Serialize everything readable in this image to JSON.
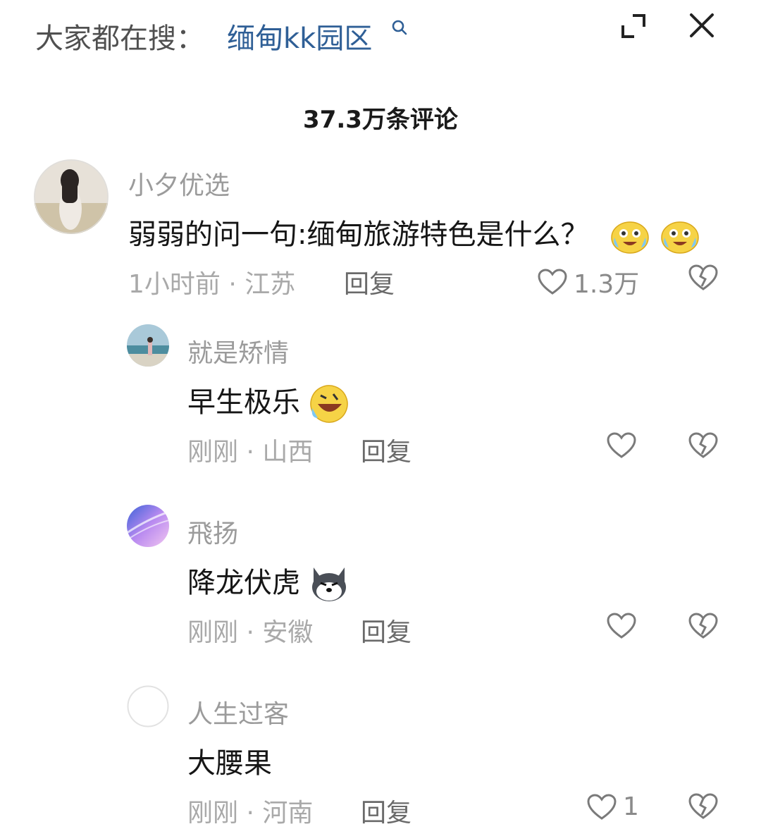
{
  "header": {
    "search_prefix": "大家都在搜：",
    "search_term": "缅甸kk园区",
    "icons": [
      "search-icon",
      "expand-icon",
      "close-icon"
    ]
  },
  "comment_count": "37.3万条评论",
  "comments": [
    {
      "username": "小夕优选",
      "text": "弱弱的问一句:缅甸旅游特色是什么？",
      "emojis": [
        "crying-laughing-emoji",
        "crying-laughing-emoji"
      ],
      "meta": "1小时前 · 江苏",
      "reply_label": "回复",
      "likes": "1.3万"
    },
    {
      "username": "就是矫情",
      "text": "早生极乐",
      "emojis": [
        "rofl-emoji"
      ],
      "meta": "刚刚 · 山西",
      "reply_label": "回复",
      "likes": ""
    },
    {
      "username": "飛扬",
      "text": "降龙伏虎",
      "emojis": [
        "husky-dog-emoji"
      ],
      "meta": "刚刚 · 安徽",
      "reply_label": "回复",
      "likes": ""
    },
    {
      "username": "人生过客",
      "text": "大腰果",
      "emojis": [],
      "meta": "刚刚 · 河南",
      "reply_label": "回复",
      "likes": "1"
    }
  ],
  "colors": {
    "search_term": "#2f5f96",
    "username": "#9b9b9b",
    "meta": "#a9a9a9",
    "text": "#161616"
  }
}
